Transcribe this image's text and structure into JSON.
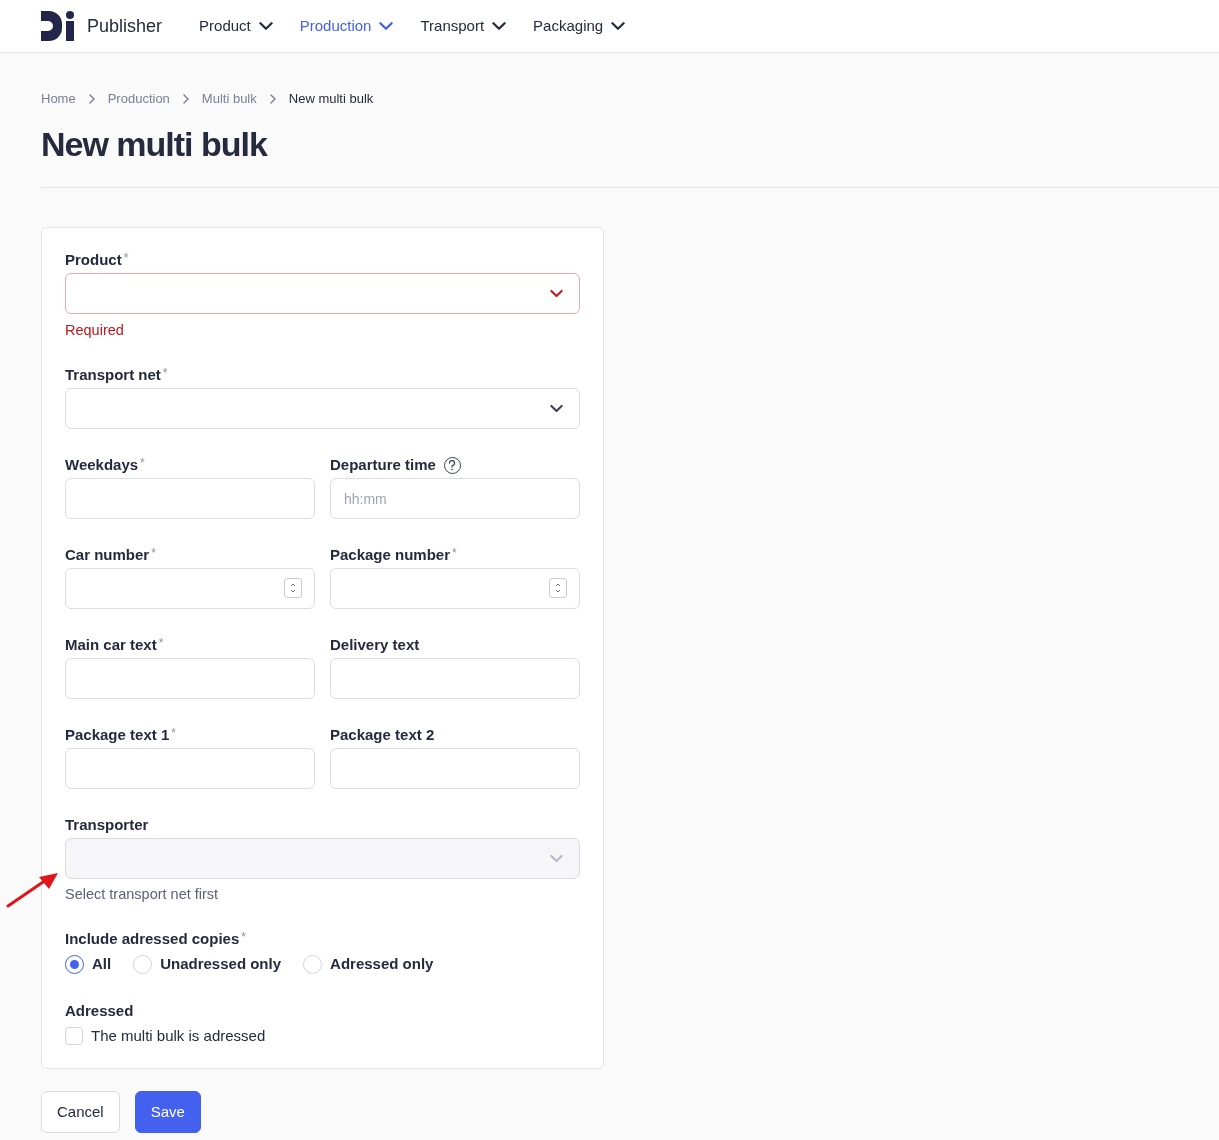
{
  "app": {
    "brand": "Publisher"
  },
  "nav": [
    {
      "label": "Product",
      "selected": false
    },
    {
      "label": "Production",
      "selected": true
    },
    {
      "label": "Transport",
      "selected": false
    },
    {
      "label": "Packaging",
      "selected": false
    }
  ],
  "breadcrumb": [
    "Home",
    "Production",
    "Multi bulk",
    "New multi bulk"
  ],
  "title": "New multi bulk",
  "form": {
    "rows": [
      [
        {
          "kind": "select",
          "label": "Product",
          "required_mark": "*",
          "invalid": true,
          "error": "Required"
        }
      ],
      [
        {
          "kind": "select",
          "label": "Transport net",
          "required_mark": "*"
        }
      ],
      [
        {
          "kind": "text",
          "label": "Weekdays",
          "required_mark": "*"
        },
        {
          "kind": "text",
          "label": "Departure time",
          "help": true,
          "placeholder": "hh:mm"
        }
      ],
      [
        {
          "kind": "number",
          "label": "Car number",
          "required_mark": "*"
        },
        {
          "kind": "number",
          "label": "Package number",
          "required_mark": "*"
        }
      ],
      [
        {
          "kind": "text",
          "label": "Main car text",
          "required_mark": "*"
        },
        {
          "kind": "text",
          "label": "Delivery text"
        }
      ],
      [
        {
          "kind": "text",
          "label": "Package text 1",
          "required_mark": "*"
        },
        {
          "kind": "text",
          "label": "Package text 2"
        }
      ],
      [
        {
          "kind": "select",
          "label": "Transporter",
          "disabled": true,
          "hint": "Select transport net first",
          "annotated": true
        }
      ]
    ],
    "radio_group": {
      "label": "Include adressed copies",
      "required_mark": "*",
      "options": [
        {
          "label": "All",
          "selected": true
        },
        {
          "label": "Unadressed only",
          "selected": false
        },
        {
          "label": "Adressed only",
          "selected": false
        }
      ]
    },
    "checkbox_group": {
      "label": "Adressed",
      "options": [
        {
          "label": "The multi bulk is adressed",
          "checked": false
        }
      ]
    }
  },
  "buttons": [
    {
      "label": "Cancel",
      "kind": "secondary"
    },
    {
      "label": "Save",
      "kind": "primary"
    }
  ]
}
